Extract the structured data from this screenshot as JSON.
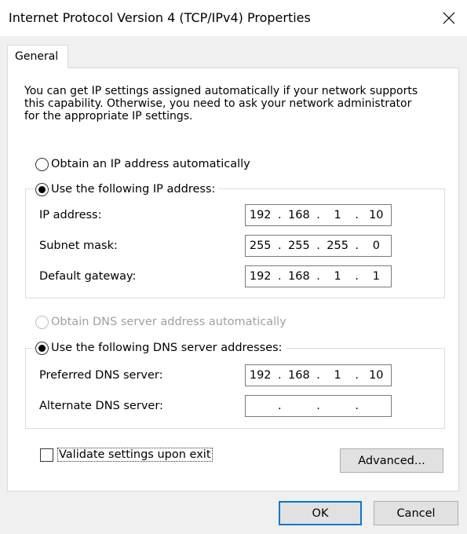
{
  "window": {
    "title": "Internet Protocol Version 4 (TCP/IPv4) Properties"
  },
  "tabs": [
    {
      "label": "General",
      "selected": true
    }
  ],
  "info_lines": [
    "You can get IP settings assigned automatically if your network supports",
    "this capability. Otherwise, you need to ask your network administrator",
    "for the appropriate IP settings."
  ],
  "ip_section": {
    "auto_label": "Obtain an IP address automatically",
    "manual_label": "Use the following IP address:",
    "selected": "manual",
    "fields": [
      {
        "label": "IP address:",
        "octets": [
          "192",
          "168",
          "1",
          "10"
        ]
      },
      {
        "label": "Subnet mask:",
        "octets": [
          "255",
          "255",
          "255",
          "0"
        ]
      },
      {
        "label": "Default gateway:",
        "octets": [
          "192",
          "168",
          "1",
          "1"
        ]
      }
    ]
  },
  "dns_section": {
    "auto_label": "Obtain DNS server address automatically",
    "auto_disabled": true,
    "manual_label": "Use the following DNS server addresses:",
    "selected": "manual",
    "fields": [
      {
        "label": "Preferred DNS server:",
        "octets": [
          "192",
          "168",
          "1",
          "10"
        ]
      },
      {
        "label": "Alternate DNS server:",
        "octets": [
          "",
          "",
          "",
          ""
        ]
      }
    ]
  },
  "validate": {
    "label": "Validate settings upon exit",
    "checked": false
  },
  "buttons": {
    "advanced": "Advanced...",
    "ok": "OK",
    "cancel": "Cancel"
  },
  "colors": {
    "default_button_border": "#0078d7",
    "disabled_text": "#a0a0a0"
  }
}
